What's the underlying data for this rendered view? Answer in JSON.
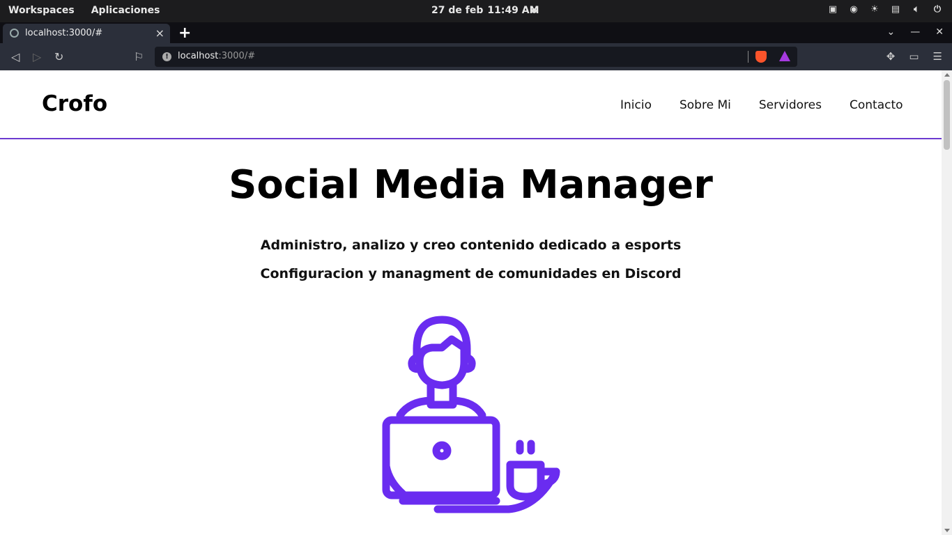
{
  "os_bar": {
    "workspaces": "Workspaces",
    "apps": "Aplicaciones",
    "date": "27 de feb",
    "time": "11:49 AM",
    "tray_icons": [
      "display-icon",
      "discord-icon",
      "brightness-icon",
      "keyboard-icon",
      "volume-icon",
      "power-icon"
    ]
  },
  "browser": {
    "tab_title": "localhost:3000/#",
    "url_host": "localhost",
    "url_path": ":3000/#",
    "accent": "#2b2f3a"
  },
  "site": {
    "brand": "Crofo",
    "nav": [
      "Inicio",
      "Sobre Mi",
      "Servidores",
      "Contacto"
    ],
    "hero_title": "Social Media Manager",
    "line1": "Administro, analizo y creo contenido dedicado a esports",
    "line2": "Configuracion y managment de comunidades en Discord",
    "accent_color": "#6a2cf0",
    "illustration": "person-with-laptop-and-coffee-icon"
  }
}
